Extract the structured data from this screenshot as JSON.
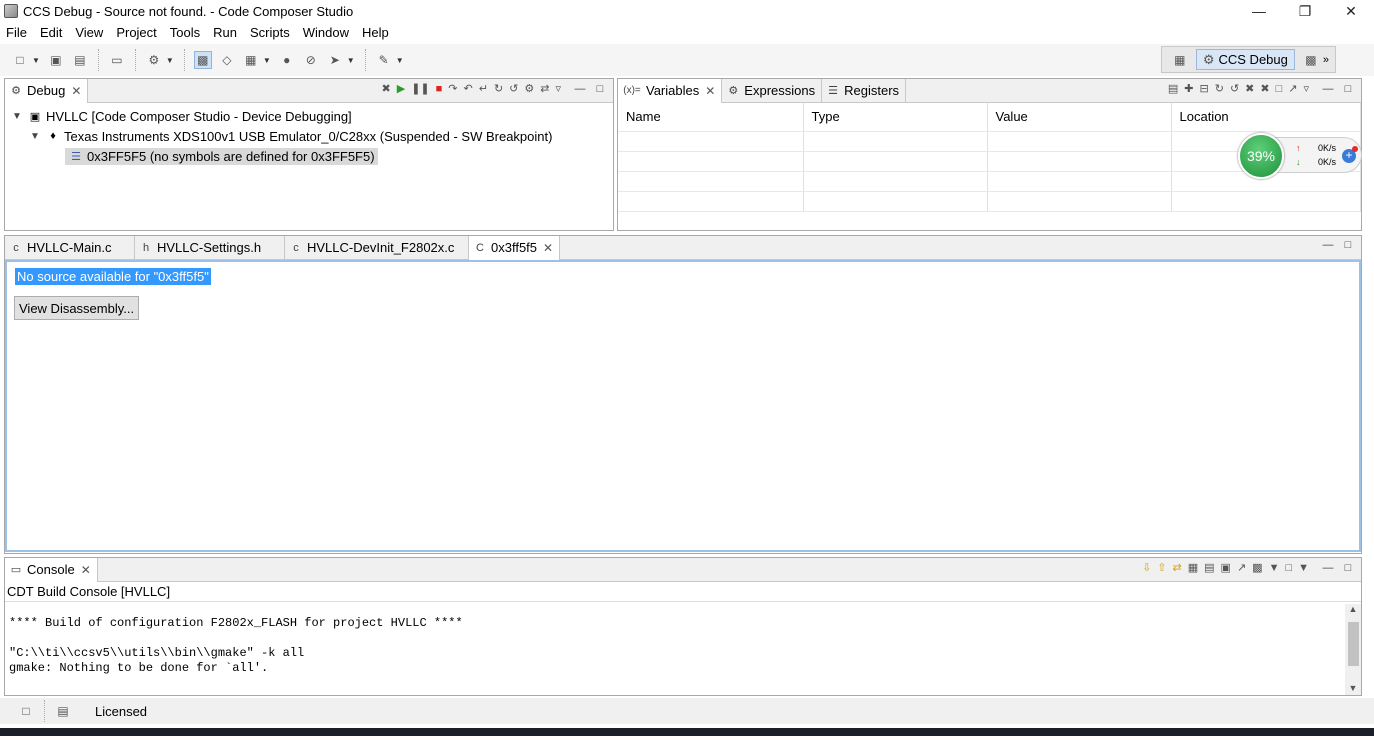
{
  "window": {
    "title": "CCS Debug - Source not found. - Code Composer Studio",
    "min": "—",
    "restore": "❐",
    "close": "✕"
  },
  "menu": [
    "File",
    "Edit",
    "View",
    "Project",
    "Tools",
    "Run",
    "Scripts",
    "Window",
    "Help"
  ],
  "perspective": {
    "label": "CCS Debug",
    "more": "»"
  },
  "debug_view": {
    "tab": "Debug",
    "tree": [
      {
        "label": "HVLLC [Code Composer Studio - Device Debugging]",
        "level": 0
      },
      {
        "label": "Texas Instruments XDS100v1 USB Emulator_0/C28xx (Suspended - SW Breakpoint)",
        "level": 1
      },
      {
        "label": "0x3FF5F5  (no symbols are defined for 0x3FF5F5)",
        "level": 2
      }
    ]
  },
  "variables_view": {
    "tabs": [
      "Variables",
      "Expressions",
      "Registers"
    ],
    "columns": [
      "Name",
      "Type",
      "Value",
      "Location"
    ]
  },
  "editor": {
    "tabs": [
      "HVLLC-Main.c",
      "HVLLC-Settings.h",
      "HVLLC-DevInit_F2802x.c",
      "0x3ff5f5"
    ],
    "message": "No source available for \"0x3ff5f5\"",
    "button": "View Disassembly..."
  },
  "console": {
    "tab": "Console",
    "label": "CDT Build Console [HVLLC]",
    "lines": [
      "**** Build of configuration F2802x_FLASH for project HVLLC ****",
      "",
      "\"C:\\\\ti\\\\ccsv5\\\\utils\\\\bin\\\\gmake\" -k all",
      "gmake: Nothing to be done for `all'."
    ]
  },
  "status": {
    "license": "Licensed"
  },
  "network_widget": {
    "percent": "39%",
    "up": "0K/s",
    "down": "0K/s"
  }
}
